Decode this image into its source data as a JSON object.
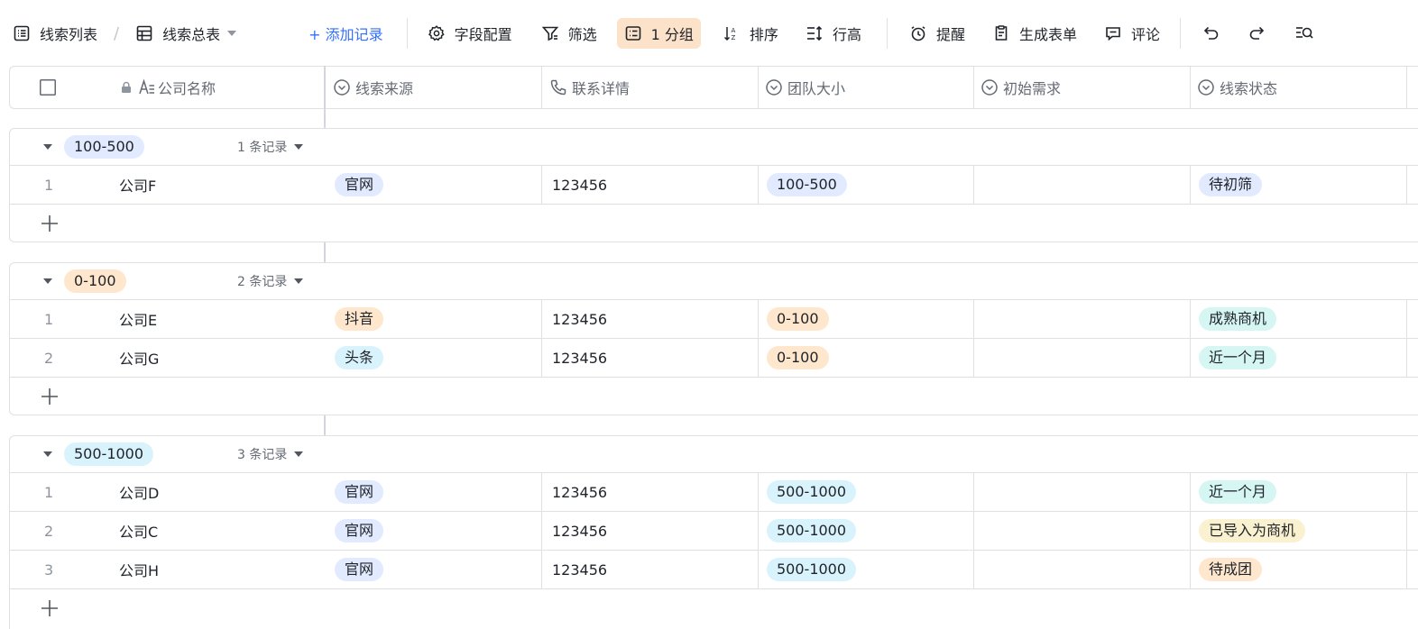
{
  "toolbar": {
    "view_list": "线索列表",
    "view_current": "线索总表",
    "add_record": "+ 添加记录",
    "field_config": "字段配置",
    "filter": "筛选",
    "group": "1 分组",
    "sort": "排序",
    "row_height": "行高",
    "reminder": "提醒",
    "form": "生成表单",
    "comment": "评论"
  },
  "columns": [
    "公司名称",
    "线索来源",
    "联系详情",
    "团队大小",
    "初始需求",
    "线索状态"
  ],
  "colors": {
    "blue_tag": "#e1eaff",
    "orange_tag": "#fee7cd",
    "cyan_tag": "#d9f3fd",
    "teal_tag": "#d5f6f2",
    "yellow_tag": "#faf1d1",
    "accent": "#3370ff"
  },
  "groups": [
    {
      "name": "100-500",
      "count": "1 条记录",
      "rows": [
        {
          "index": "1",
          "company": "公司F",
          "source": "官网",
          "contact": "123456",
          "team": "100-500",
          "need": "",
          "status": "待初筛"
        }
      ]
    },
    {
      "name": "0-100",
      "count": "2 条记录",
      "rows": [
        {
          "index": "1",
          "company": "公司E",
          "source": "抖音",
          "contact": "123456",
          "team": "0-100",
          "need": "",
          "status": "成熟商机"
        },
        {
          "index": "2",
          "company": "公司G",
          "source": "头条",
          "contact": "123456",
          "team": "0-100",
          "need": "",
          "status": "近一个月"
        }
      ]
    },
    {
      "name": "500-1000",
      "count": "3 条记录",
      "rows": [
        {
          "index": "1",
          "company": "公司D",
          "source": "官网",
          "contact": "123456",
          "team": "500-1000",
          "need": "",
          "status": "近一个月"
        },
        {
          "index": "2",
          "company": "公司C",
          "source": "官网",
          "contact": "123456",
          "team": "500-1000",
          "need": "",
          "status": "已导入为商机"
        },
        {
          "index": "3",
          "company": "公司H",
          "source": "官网",
          "contact": "123456",
          "team": "500-1000",
          "need": "",
          "status": "待成团"
        }
      ]
    }
  ]
}
